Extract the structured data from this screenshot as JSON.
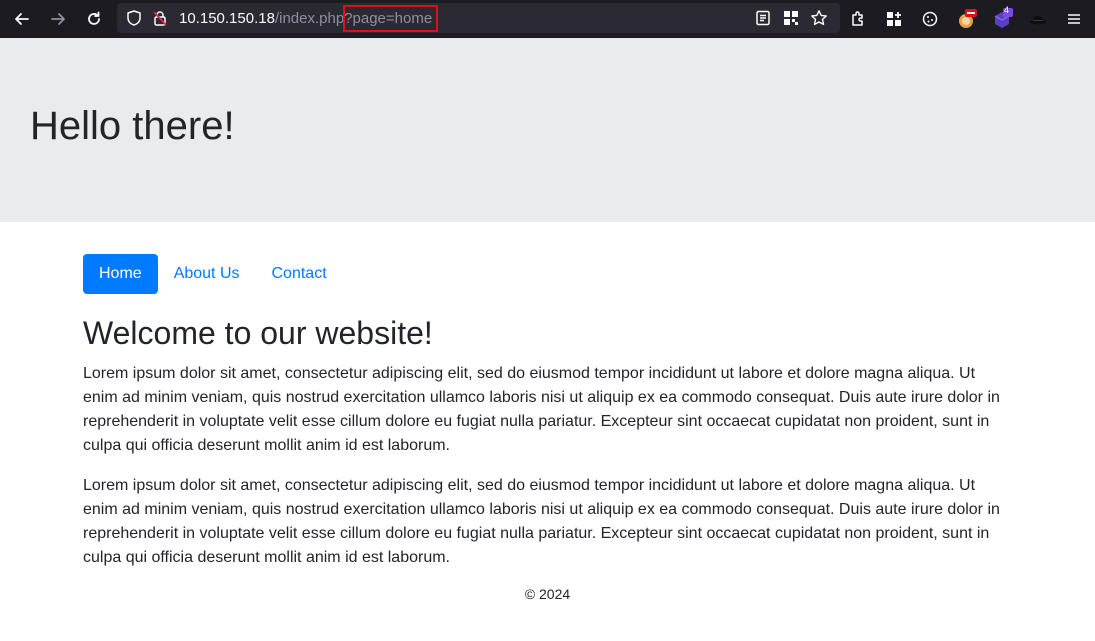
{
  "browser": {
    "url_host": "10.150.150.18",
    "url_path": "/index.php",
    "url_query": "?page=home",
    "extension_badge": "4",
    "icons": [
      "back-icon",
      "forward-icon",
      "reload-icon",
      "shield-icon",
      "lock-icon",
      "reader-icon",
      "qr-icon",
      "bookmark-star-icon",
      "extensions-icon",
      "puzzle-icon",
      "cookie-icon",
      "extension-icon",
      "extension-icon",
      "hat-icon",
      "menu-icon"
    ]
  },
  "jumbotron": {
    "title": "Hello there!"
  },
  "nav": {
    "items": [
      {
        "label": "Home",
        "active": true
      },
      {
        "label": "About Us",
        "active": false
      },
      {
        "label": "Contact",
        "active": false
      }
    ]
  },
  "main": {
    "heading": "Welcome to our website!",
    "paragraphs": [
      "Lorem ipsum dolor sit amet, consectetur adipiscing elit, sed do eiusmod tempor incididunt ut labore et dolore magna aliqua. Ut enim ad minim veniam, quis nostrud exercitation ullamco laboris nisi ut aliquip ex ea commodo consequat. Duis aute irure dolor in reprehenderit in voluptate velit esse cillum dolore eu fugiat nulla pariatur. Excepteur sint occaecat cupidatat non proident, sunt in culpa qui officia deserunt mollit anim id est laborum.",
      "Lorem ipsum dolor sit amet, consectetur adipiscing elit, sed do eiusmod tempor incididunt ut labore et dolore magna aliqua. Ut enim ad minim veniam, quis nostrud exercitation ullamco laboris nisi ut aliquip ex ea commodo consequat. Duis aute irure dolor in reprehenderit in voluptate velit esse cillum dolore eu fugiat nulla pariatur. Excepteur sint occaecat cupidatat non proident, sunt in culpa qui officia deserunt mollit anim id est laborum."
    ]
  },
  "footer": {
    "text": "© 2024"
  },
  "colors": {
    "toolbar_bg": "#1c1b22",
    "urlbar_bg": "#2b2a33",
    "jumbotron_bg": "#e9ecef",
    "primary": "#007bff",
    "highlight_border": "#e0101a"
  }
}
